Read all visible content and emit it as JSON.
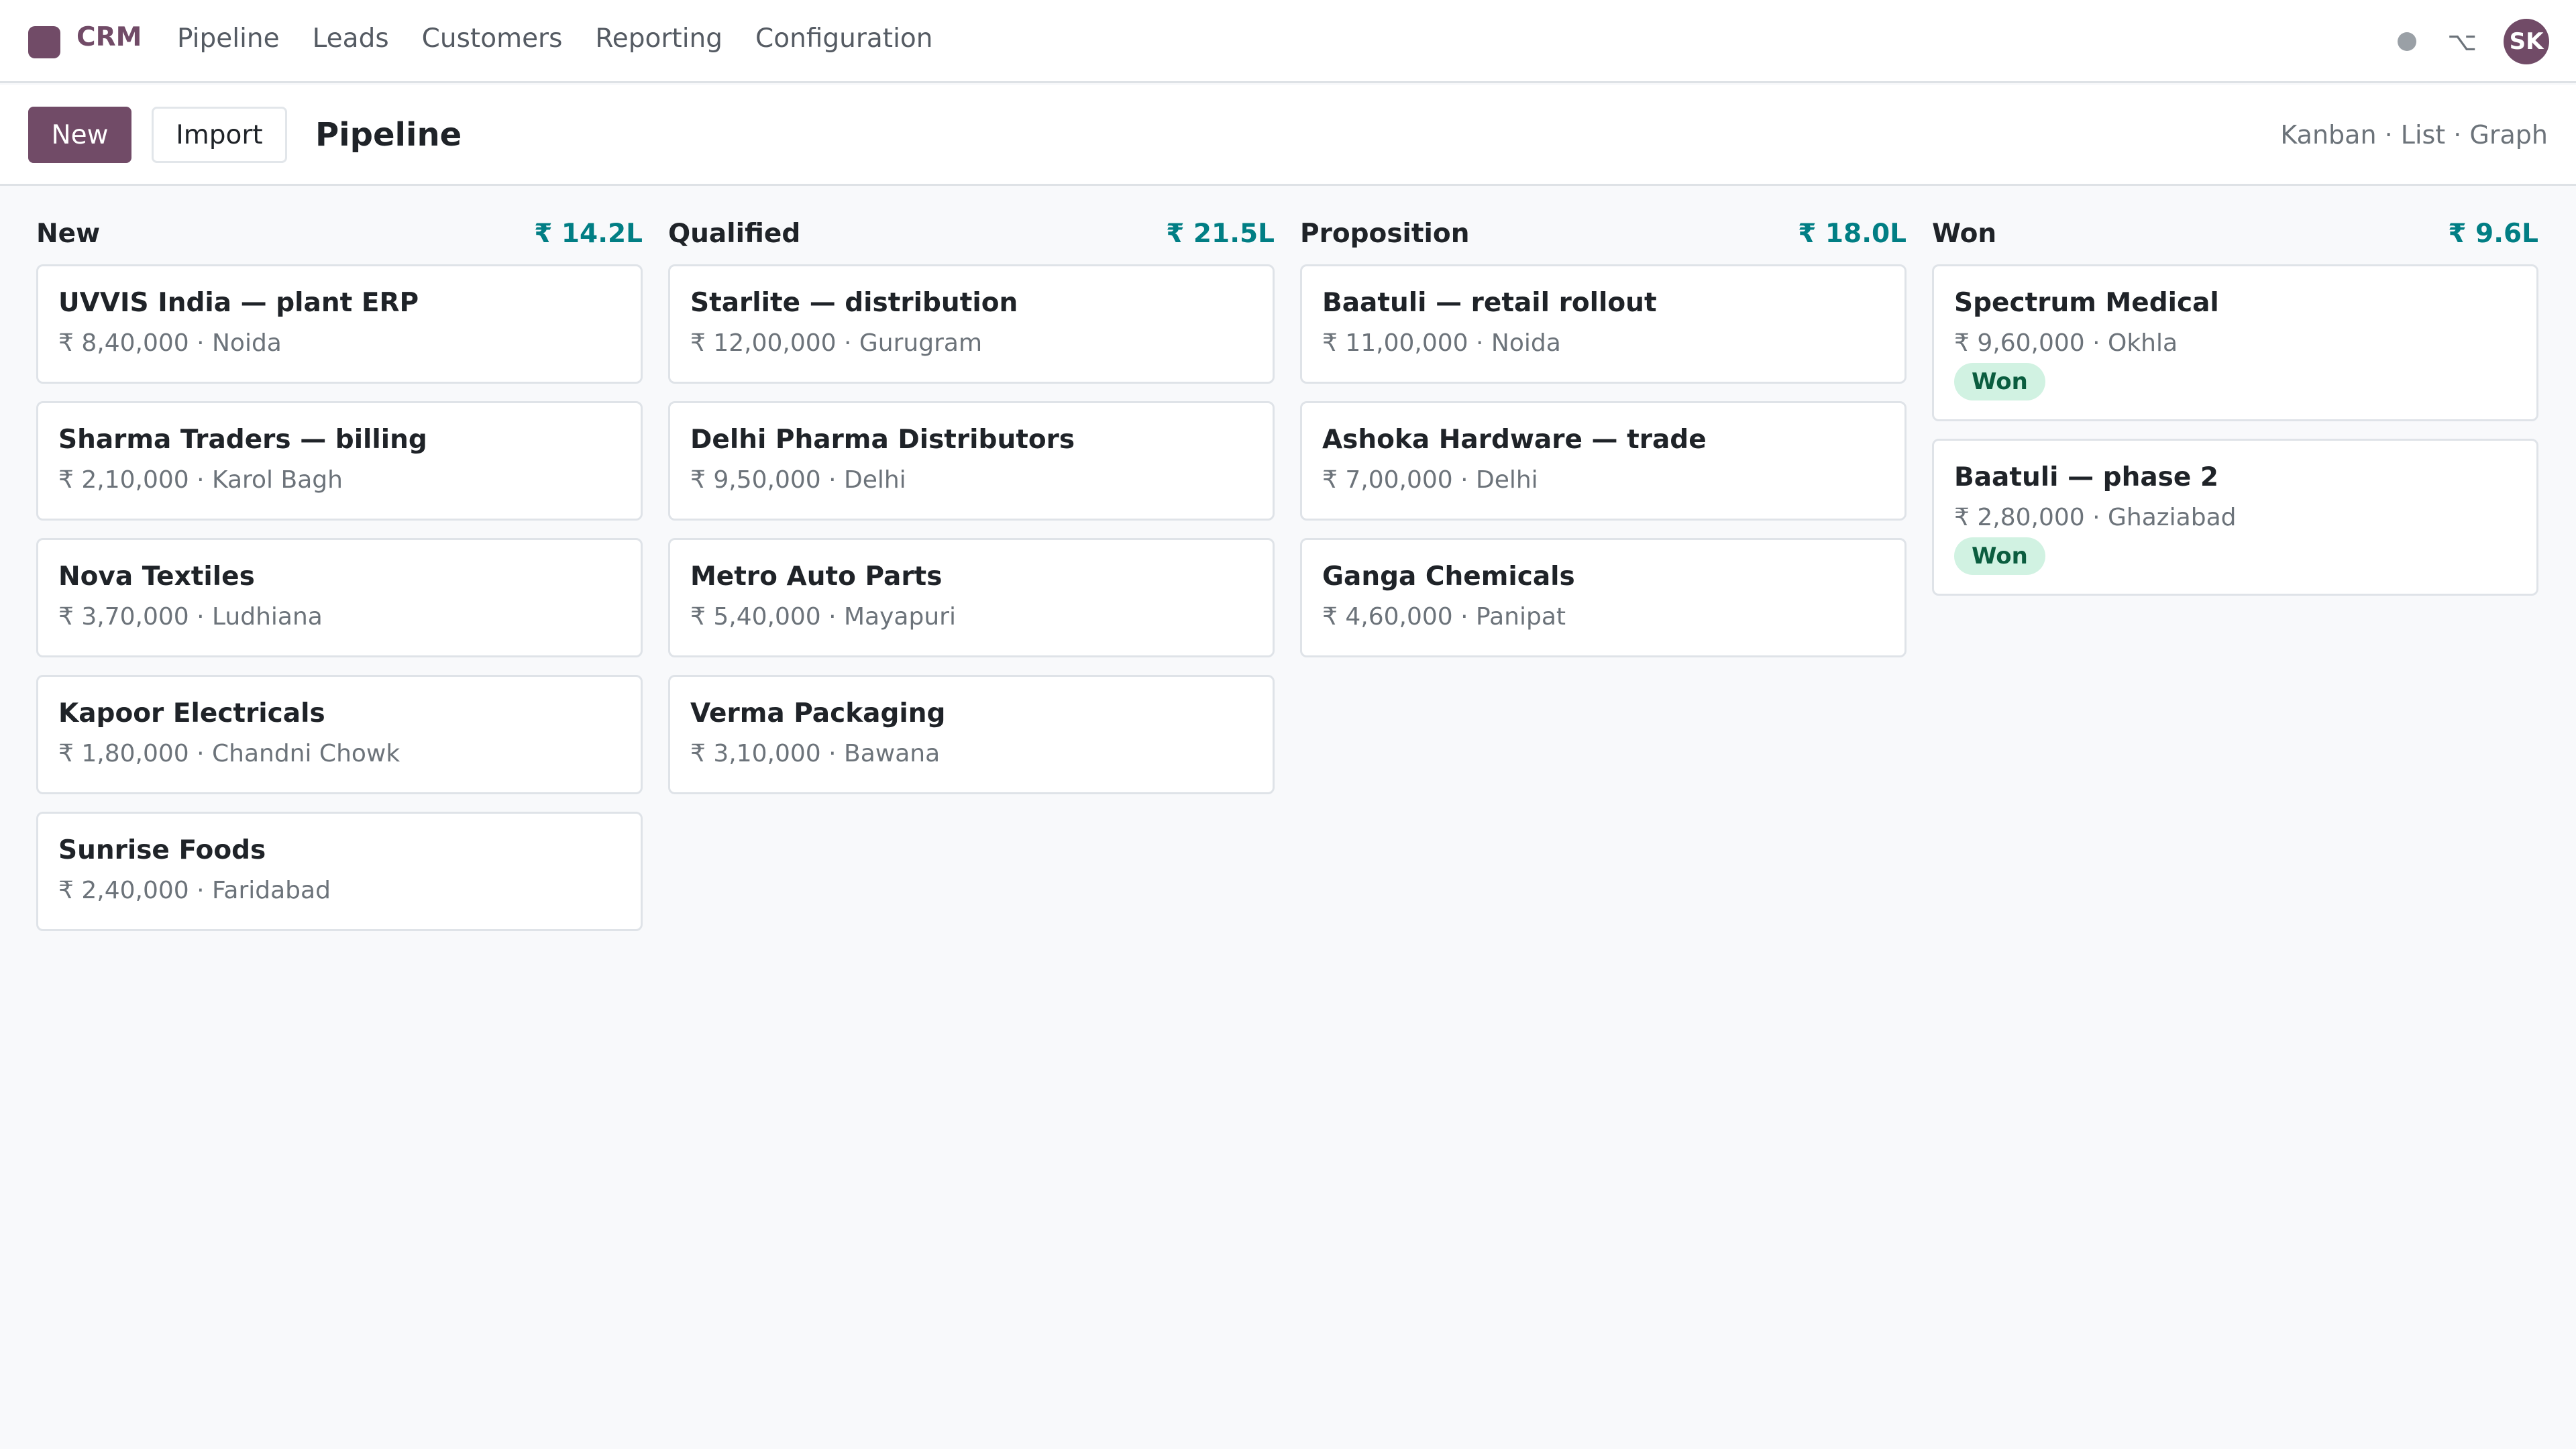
{
  "app": {
    "name": "CRM"
  },
  "nav": {
    "items": [
      "Pipeline",
      "Leads",
      "Customers",
      "Reporting",
      "Configuration"
    ],
    "debug_glyph": "⌥",
    "user_initials": "SK"
  },
  "control": {
    "new_label": "New",
    "import_label": "Import",
    "title": "Pipeline",
    "views": "Kanban · List · Graph"
  },
  "columns": [
    {
      "title": "New",
      "total": "₹ 14.2L",
      "cards": [
        {
          "name": "UVVIS India — plant ERP",
          "meta": "₹ 8,40,000 · Noida"
        },
        {
          "name": "Sharma Traders — billing",
          "meta": "₹ 2,10,000 · Karol Bagh"
        },
        {
          "name": "Nova Textiles",
          "meta": "₹ 3,70,000 · Ludhiana"
        },
        {
          "name": "Kapoor Electricals",
          "meta": "₹ 1,80,000 · Chandni Chowk"
        },
        {
          "name": "Sunrise Foods",
          "meta": "₹ 2,40,000 · Faridabad"
        }
      ]
    },
    {
      "title": "Qualified",
      "total": "₹ 21.5L",
      "cards": [
        {
          "name": "Starlite — distribution",
          "meta": "₹ 12,00,000 · Gurugram"
        },
        {
          "name": "Delhi Pharma Distributors",
          "meta": "₹ 9,50,000 · Delhi"
        },
        {
          "name": "Metro Auto Parts",
          "meta": "₹ 5,40,000 · Mayapuri"
        },
        {
          "name": "Verma Packaging",
          "meta": "₹ 3,10,000 · Bawana"
        }
      ]
    },
    {
      "title": "Proposition",
      "total": "₹ 18.0L",
      "cards": [
        {
          "name": "Baatuli — retail rollout",
          "meta": "₹ 11,00,000 · Noida"
        },
        {
          "name": "Ashoka Hardware — trade",
          "meta": "₹ 7,00,000 · Delhi"
        },
        {
          "name": "Ganga Chemicals",
          "meta": "₹ 4,60,000 · Panipat"
        }
      ]
    },
    {
      "title": "Won",
      "total": "₹ 9.6L",
      "cards": [
        {
          "name": "Spectrum Medical",
          "meta": "₹ 9,60,000 · Okhla",
          "tag": "Won"
        },
        {
          "name": "Baatuli — phase 2",
          "meta": "₹ 2,80,000 · Ghaziabad",
          "tag": "Won"
        }
      ]
    }
  ],
  "colors": {
    "brand": "#714b67",
    "total": "#017e84",
    "won_tag_bg": "#d1f2e2",
    "won_tag_text": "#0b5d3f"
  }
}
